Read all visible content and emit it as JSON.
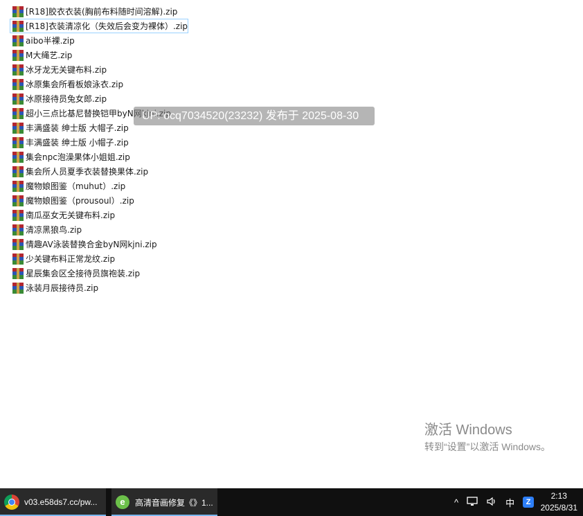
{
  "files": [
    "[R18]胶衣衣装(胸前布料随时间溶解).zip",
    "[R18]衣装清凉化（失效后会变为裸体）.zip",
    "aibo半裸.zip",
    "M大绳艺.zip",
    "冰牙龙无关键布料.zip",
    "冰原集会所看板娘泳衣.zip",
    "冰原接待员兔女郎.zip",
    "超小三点比基尼替换铠甲byN网kjni.zip",
    "丰满盛装 绅士版 大帽子.zip",
    "丰满盛装 绅士版 小帽子.zip",
    "集会npc泡澡果体小姐姐.zip",
    "集会所人员夏季衣装替换果体.zip",
    "魔物娘图鉴（muhut）.zip",
    "魔物娘图鉴（prousoul）.zip",
    "南瓜巫女无关键布料.zip",
    "清凉黑狼鸟.zip",
    "情趣AV泳装替换合金byN网kjni.zip",
    "少关键布料正常龙纹.zip",
    "星辰集会区全接待员旗袍装.zip",
    "泳装月辰接待员.zip"
  ],
  "selected_index": 1,
  "watermark": "UP: ocq7034520(23232) 发布于 2025-08-30",
  "activation": {
    "title": "激活 Windows",
    "subtitle": "转到“设置”以激活 Windows。"
  },
  "taskbar": {
    "items": [
      {
        "label": "v03.e58ds7.cc/pw...",
        "icon": "chrome-icon"
      },
      {
        "label": "高清音画修复《》1...",
        "icon": "media-player-icon"
      }
    ],
    "tray": {
      "ime": "中",
      "time": "2:13",
      "date": "2025/8/31"
    }
  },
  "colors": {
    "selection_border": "#99d1ff",
    "taskbar_bg": "#101010",
    "taskbar_accent": "#79b6ee"
  }
}
